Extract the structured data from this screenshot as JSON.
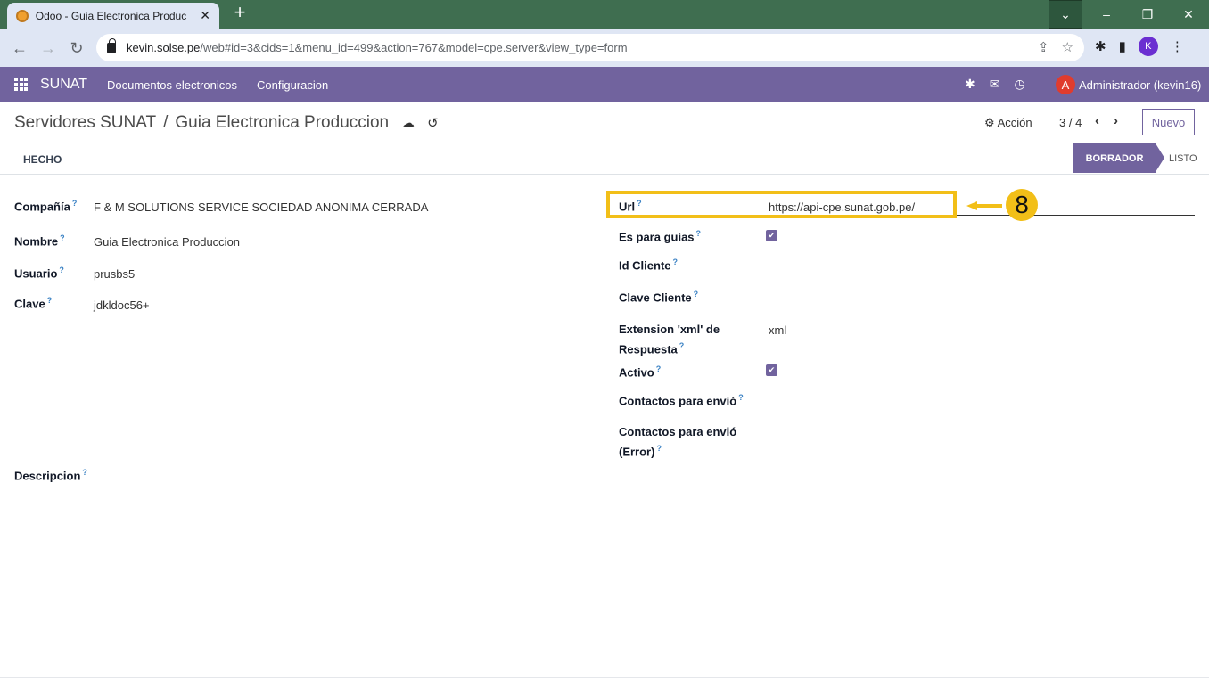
{
  "browser": {
    "tab_title": "Odoo - Guia Electronica Produc",
    "tab_close": "✕",
    "new_tab": "+",
    "url_host": "kevin.solse.pe",
    "url_path": "/web#id=3&cids=1&menu_id=499&action=767&model=cpe.server&view_type=form",
    "profile_initial": "K"
  },
  "navbar": {
    "brand": "SUNAT",
    "menu": [
      "Documentos electronicos",
      "Configuracion"
    ],
    "user_initial": "A",
    "user_name": "Administrador (kevin16)"
  },
  "control": {
    "breadcrumb_parent": "Servidores SUNAT",
    "breadcrumb_sep": "/",
    "breadcrumb_current": "Guia Electronica Produccion",
    "action_label": "Acción",
    "pager": "3 / 4",
    "new_button": "Nuevo"
  },
  "statusbar": {
    "left_button": "HECHO",
    "stages": [
      "BORRADOR",
      "LISTO"
    ],
    "active_stage": "BORRADOR"
  },
  "form": {
    "left": [
      {
        "label": "Compañía",
        "value": "F & M SOLUTIONS SERVICE SOCIEDAD ANONIMA CERRADA"
      },
      {
        "label": "Nombre",
        "value": "Guia Electronica Produccion"
      },
      {
        "label": "Usuario",
        "value": "prusbs5"
      },
      {
        "label": "Clave",
        "value": "jdkldoc56+"
      }
    ],
    "right": {
      "url_label": "Url",
      "url_value": "https://api-cpe.sunat.gob.pe/",
      "guias_label": "Es para guías",
      "guias_checked": true,
      "id_cliente_label": "Id Cliente",
      "clave_cliente_label": "Clave Cliente",
      "extension_label_1": "Extension 'xml' de",
      "extension_label_2": "Respuesta",
      "extension_value": "xml",
      "activo_label": "Activo",
      "activo_checked": true,
      "contactos_label": "Contactos para envió",
      "contactos_error_label_1": "Contactos para envió",
      "contactos_error_label_2": "(Error)"
    },
    "descripcion_label": "Descripcion",
    "help_mark": "?"
  },
  "annotation": {
    "step_number": "8",
    "color": "#f2bf18"
  }
}
